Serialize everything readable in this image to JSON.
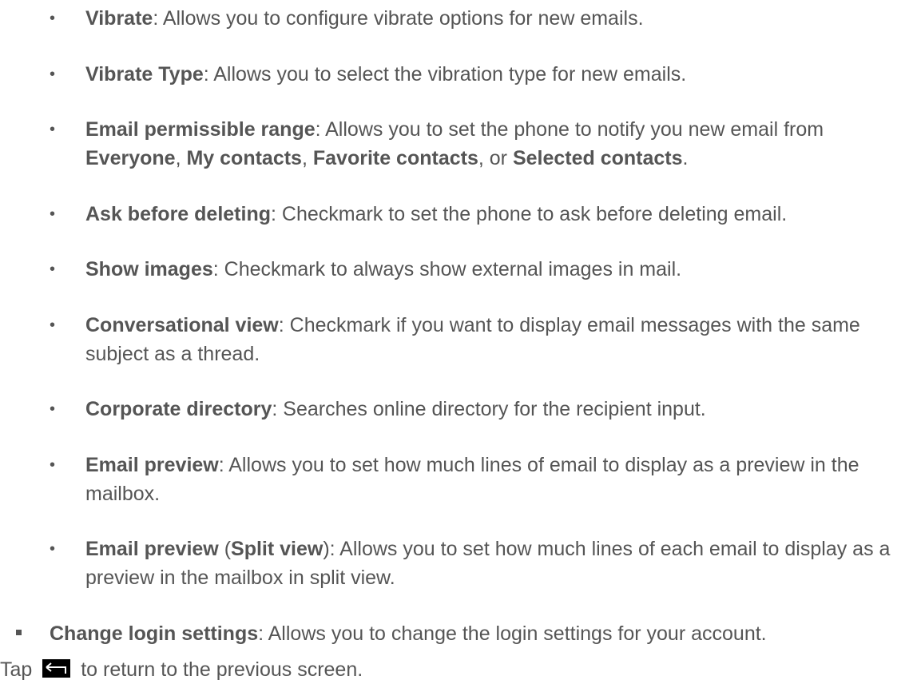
{
  "sub_items": [
    {
      "term": "Vibrate",
      "rest": ": Allows you to configure vibrate options for new emails."
    },
    {
      "term": "Vibrate Type",
      "rest": ": Allows you to select the vibration type for new emails."
    },
    {
      "term": "Email permissible range",
      "rest_a": ": Allows you to set the phone to notify you new email from ",
      "opt1": "Everyone",
      "sep1": ", ",
      "opt2": "My contacts",
      "sep2": ", ",
      "opt3": "Favorite contacts",
      "sep3": ", or ",
      "opt4": "Selected contacts",
      "end": "."
    },
    {
      "term": "Ask before deleting",
      "rest": ": Checkmark to set the phone to ask before deleting email."
    },
    {
      "term": "Show images",
      "rest": ": Checkmark to always show external images in mail."
    },
    {
      "term": "Conversational view",
      "rest": ": Checkmark if you want to display email messages with the same subject as a thread."
    },
    {
      "term": "Corporate directory",
      "rest": ": Searches online directory for the recipient input."
    },
    {
      "term": "Email preview",
      "rest": ": Allows you to set how much lines of email to display as a preview in the mailbox."
    },
    {
      "term": "Email preview",
      "paren_open": " (",
      "paren_term": "Split view",
      "paren_close": ")",
      "rest": ": Allows you to set how much lines of each email to display as a preview in the mailbox in split view."
    }
  ],
  "bullet_char": "•",
  "main_item": {
    "term": "Change login settings",
    "rest": ": Allows you to change the login settings for your account."
  },
  "footer": {
    "before": "Tap ",
    "after": " to return to the previous screen.",
    "icon": "back-icon"
  }
}
